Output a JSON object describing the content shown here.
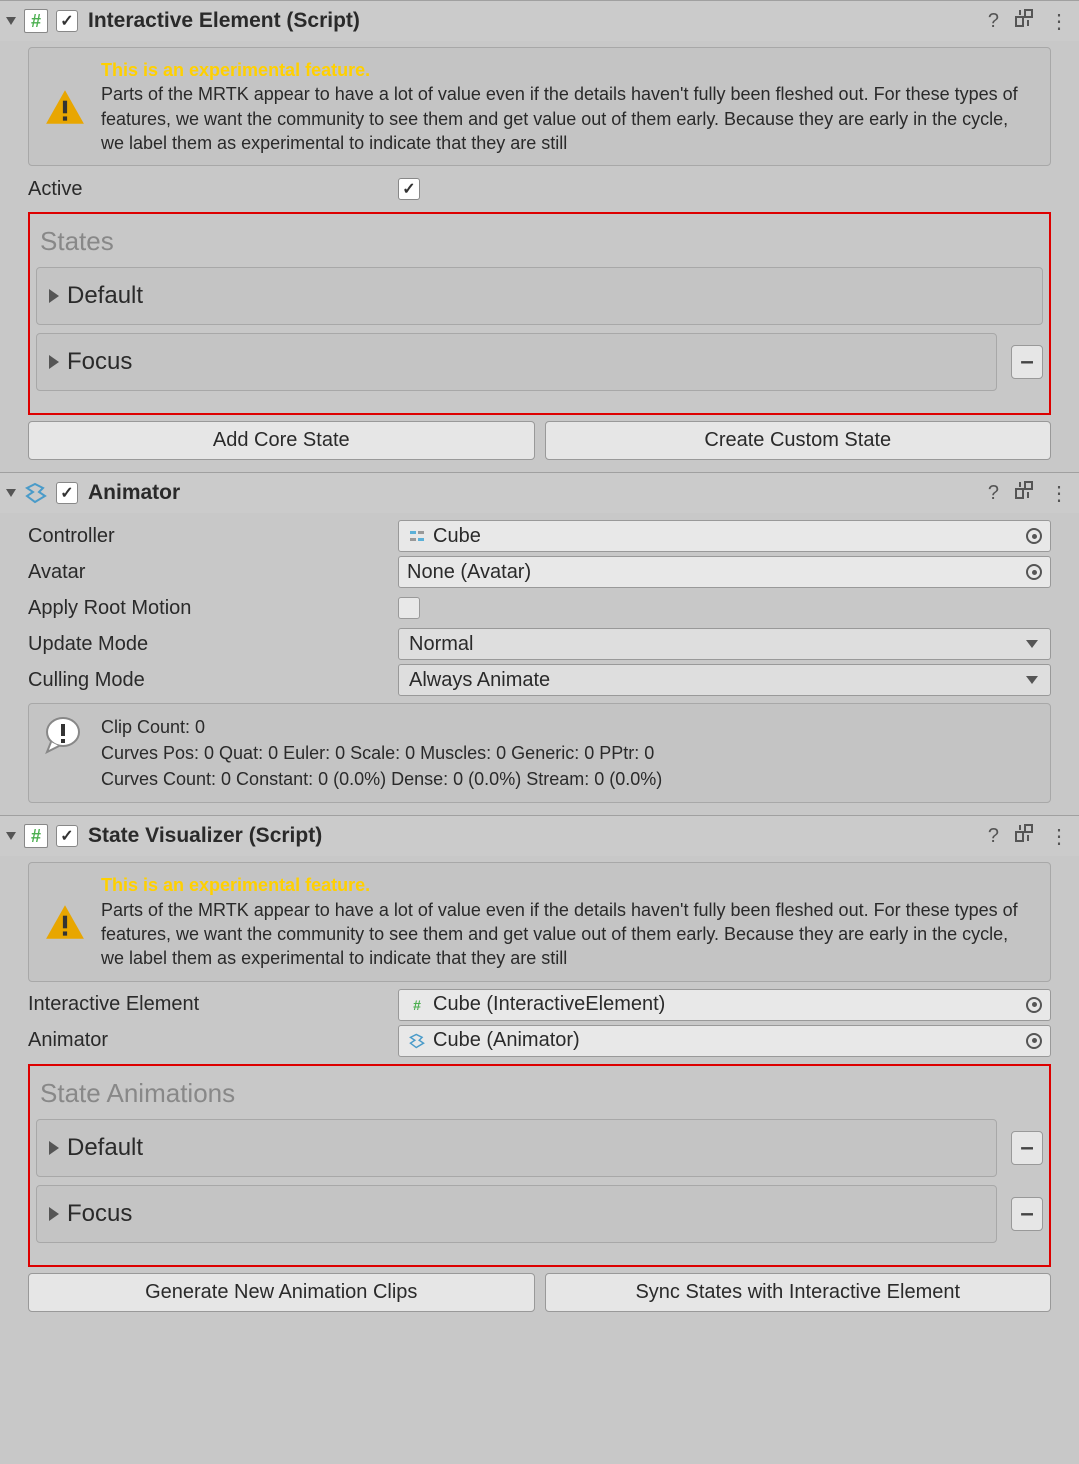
{
  "interactive": {
    "title": "Interactive Element (Script)",
    "warn_title": "This is an experimental feature.",
    "warn_body": "Parts of the MRTK appear to have a lot of value even if the details haven't fully been fleshed out. For these types of features, we want the community to see them and get value out of them early. Because they are early in the cycle, we label them as experimental to indicate that they are still",
    "active_label": "Active",
    "states_title": "States",
    "states": [
      "Default",
      "Focus"
    ],
    "btn_add_core": "Add Core State",
    "btn_custom": "Create Custom State"
  },
  "animator": {
    "title": "Animator",
    "controller_label": "Controller",
    "controller_value": "Cube",
    "avatar_label": "Avatar",
    "avatar_value": "None (Avatar)",
    "root_motion_label": "Apply Root Motion",
    "update_mode_label": "Update Mode",
    "update_mode_value": "Normal",
    "culling_mode_label": "Culling Mode",
    "culling_mode_value": "Always Animate",
    "info_line1": "Clip Count: 0",
    "info_line2": "Curves Pos: 0 Quat: 0 Euler: 0 Scale: 0 Muscles: 0 Generic: 0 PPtr: 0",
    "info_line3": "Curves Count: 0 Constant: 0 (0.0%) Dense: 0 (0.0%) Stream: 0 (0.0%)"
  },
  "visualizer": {
    "title": "State Visualizer (Script)",
    "warn_title": "This is an experimental feature.",
    "warn_body": "Parts of the MRTK appear to have a lot of value even if the details haven't fully been fleshed out. For these types of features, we want the community to see them and get value out of them early. Because they are early in the cycle, we label them as experimental to indicate that they are still",
    "ie_label": "Interactive Element",
    "ie_value": "Cube (InteractiveElement)",
    "anim_label": "Animator",
    "anim_value": "Cube (Animator)",
    "anim_title": "State Animations",
    "states": [
      "Default",
      "Focus"
    ],
    "btn_generate": "Generate New Animation Clips",
    "btn_sync": "Sync States with Interactive Element"
  }
}
